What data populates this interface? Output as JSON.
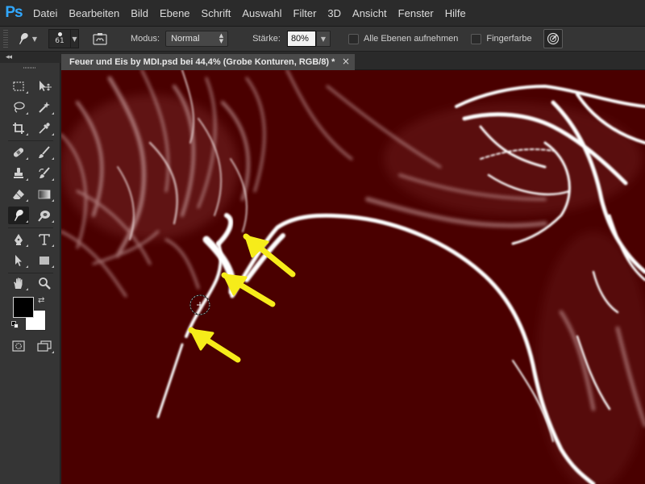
{
  "app": {
    "logo": "Ps",
    "menu": [
      "Datei",
      "Bearbeiten",
      "Bild",
      "Ebene",
      "Schrift",
      "Auswahl",
      "Filter",
      "3D",
      "Ansicht",
      "Fenster",
      "Hilfe"
    ]
  },
  "options": {
    "brush_size": "61",
    "mode_label": "Modus:",
    "mode_value": "Normal",
    "strength_label": "Stärke:",
    "strength_value": "80%",
    "sample_all_layers_label": "Alle Ebenen aufnehmen",
    "finger_painting_label": "Fingerfarbe",
    "sample_all_layers_checked": false,
    "finger_painting_checked": false
  },
  "toolbox": {
    "collapse_label": "◂◂",
    "foreground_color": "#000000",
    "background_color": "#ffffff"
  },
  "document": {
    "tab_title": "Feuer und Eis by MDI.psd bei 44,4% (Grobe Konturen, RGB/8) *",
    "close_label": "×",
    "canvas_color": "#4a0000",
    "annotation_arrow_color": "#f6ec1a",
    "annotation_arrow_count": 3
  },
  "colors": {
    "accent_logo": "#31a8ff",
    "menu_background": "#2b2b2b",
    "panel_background": "#353535"
  }
}
